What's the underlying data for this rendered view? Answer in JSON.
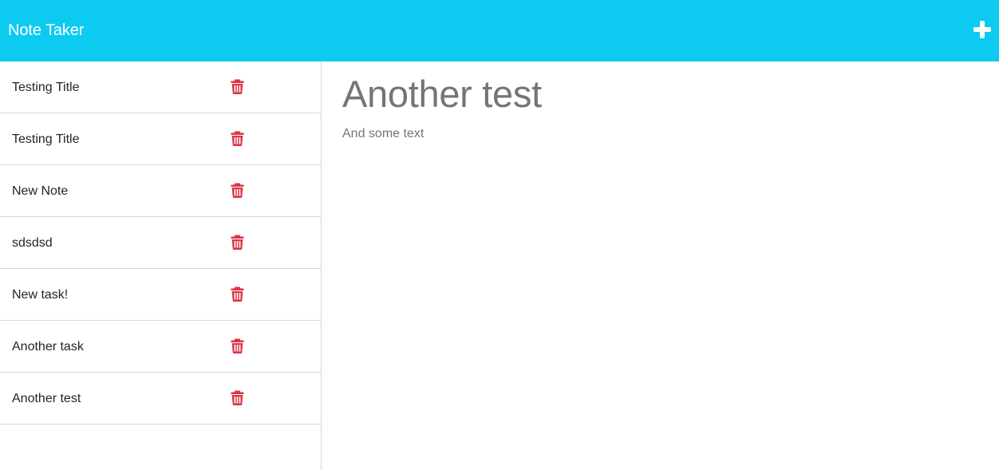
{
  "app": {
    "title": "Note Taker",
    "new_note_icon": "plus-icon",
    "accent_color": "#0dcaf0",
    "delete_color": "#dc3545"
  },
  "notes": [
    {
      "title": "Testing Title",
      "delete_icon": "trash-icon"
    },
    {
      "title": "Testing Title",
      "delete_icon": "trash-icon"
    },
    {
      "title": "New Note",
      "delete_icon": "trash-icon"
    },
    {
      "title": "sdsdsd",
      "delete_icon": "trash-icon"
    },
    {
      "title": "New task!",
      "delete_icon": "trash-icon"
    },
    {
      "title": "Another task",
      "delete_icon": "trash-icon"
    },
    {
      "title": "Another test",
      "delete_icon": "trash-icon"
    }
  ],
  "active_note": {
    "title": "Another test",
    "text": "And some text"
  }
}
